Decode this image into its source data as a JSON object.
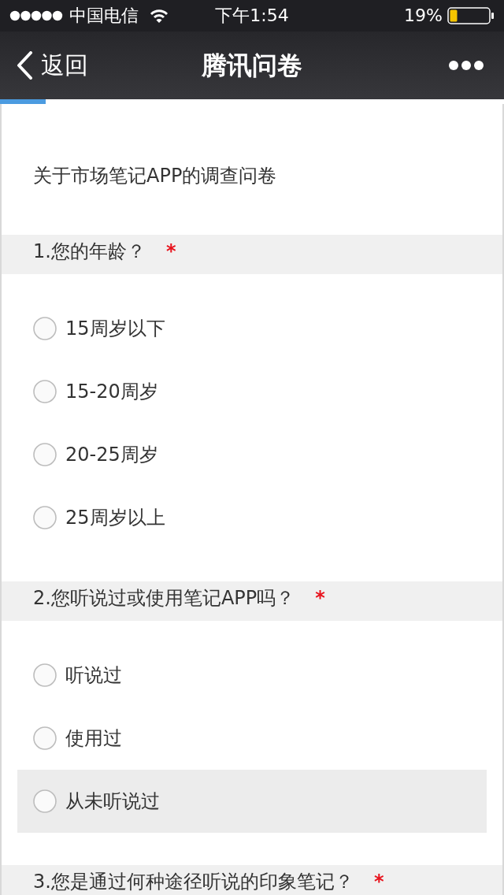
{
  "status_bar": {
    "carrier": "中国电信",
    "time": "下午1:54",
    "battery": "19%"
  },
  "nav_bar": {
    "back_label": "返回",
    "title": "腾讯问卷"
  },
  "progress": {
    "level": 0.09
  },
  "description": "关于市场笔记APP的调查问卷",
  "questions": [
    {
      "title": "1.您的年龄？",
      "required_mark": "*",
      "options": [
        {
          "label": "15周岁以下",
          "selected": false,
          "highlighted": false
        },
        {
          "label": "15-20周岁",
          "selected": false,
          "highlighted": false
        },
        {
          "label": "20-25周岁",
          "selected": false,
          "highlighted": false
        },
        {
          "label": "25周岁以上",
          "selected": false,
          "highlighted": false
        }
      ]
    },
    {
      "title": "2.您听说过或使用笔记APP吗？",
      "required_mark": "*",
      "options": [
        {
          "label": "听说过",
          "selected": false,
          "highlighted": false
        },
        {
          "label": "使用过",
          "selected": false,
          "highlighted": false
        },
        {
          "label": "从未听说过",
          "selected": false,
          "highlighted": true
        }
      ]
    },
    {
      "title": "3.您是通过何种途径听说的印象笔记？",
      "required_mark": "*"
    }
  ]
}
